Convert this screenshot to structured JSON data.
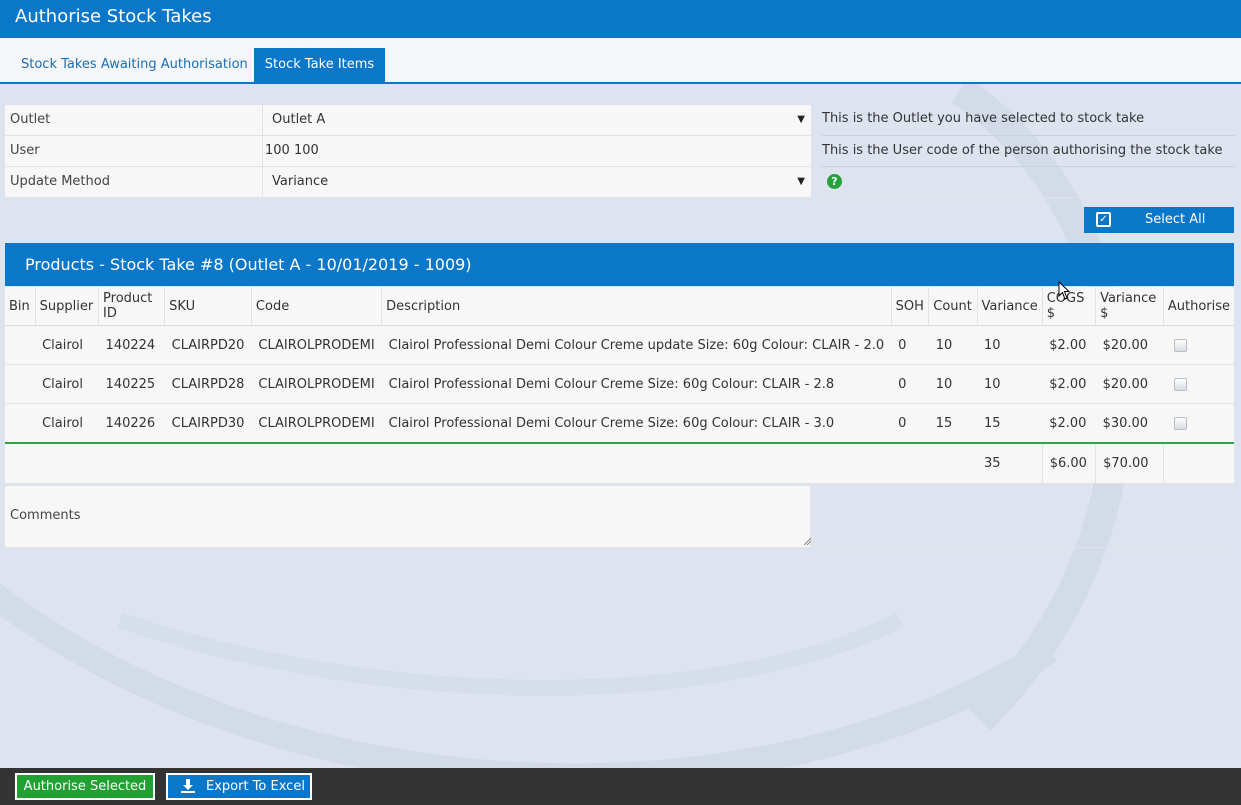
{
  "window": {
    "title": "Authorise Stock Takes"
  },
  "tabs": [
    {
      "label": "Stock Takes Awaiting Authorisation",
      "active": false
    },
    {
      "label": "Stock Take Items",
      "active": true
    }
  ],
  "form": {
    "outlet": {
      "label": "Outlet",
      "value": "Outlet A",
      "help": "This is the Outlet you have selected to stock take"
    },
    "user": {
      "label": "User",
      "value": "100 100",
      "help": "This is the User code of the person authorising the stock take"
    },
    "update_method": {
      "label": "Update Method",
      "value": "Variance",
      "help_icon": "question-circle-icon"
    }
  },
  "select_all": {
    "label": "Select All",
    "icon": "checkbox-checked-icon"
  },
  "products_panel": {
    "title": "Products - Stock Take #8 (Outlet A - 10/01/2019 - 1009)"
  },
  "table": {
    "headers": [
      "Bin",
      "Supplier",
      "Product ID",
      "SKU",
      "Code",
      "Description",
      "SOH",
      "Count",
      "Variance",
      "COGS $",
      "Variance $",
      "Authorise"
    ],
    "rows": [
      {
        "bin": "",
        "supplier": "Clairol",
        "product_id": "140224",
        "sku": "CLAIRPD20",
        "code": "CLAIROLPRODEMI",
        "description": "Clairol Professional Demi Colour Creme update Size: 60g Colour: CLAIR - 2.0",
        "soh": "0",
        "count": "10",
        "variance": "10",
        "cogs": "$2.00",
        "variance_dollar": "$20.00",
        "authorised": false
      },
      {
        "bin": "",
        "supplier": "Clairol",
        "product_id": "140225",
        "sku": "CLAIRPD28",
        "code": "CLAIROLPRODEMI",
        "description": "Clairol Professional Demi Colour Creme Size: 60g Colour: CLAIR - 2.8",
        "soh": "0",
        "count": "10",
        "variance": "10",
        "cogs": "$2.00",
        "variance_dollar": "$20.00",
        "authorised": false
      },
      {
        "bin": "",
        "supplier": "Clairol",
        "product_id": "140226",
        "sku": "CLAIRPD30",
        "code": "CLAIROLPRODEMI",
        "description": "Clairol Professional Demi Colour Creme Size: 60g Colour: CLAIR - 3.0",
        "soh": "0",
        "count": "15",
        "variance": "15",
        "cogs": "$2.00",
        "variance_dollar": "$30.00",
        "authorised": false
      }
    ],
    "totals": {
      "variance": "35",
      "cogs": "$6.00",
      "variance_dollar": "$70.00"
    }
  },
  "comments": {
    "label": "Comments",
    "value": ""
  },
  "footer": {
    "authorise_label": "Authorise Selected",
    "export_label": "Export To Excel",
    "export_icon": "download-icon"
  },
  "colors": {
    "primary": "#0a77c9",
    "success": "#22a133",
    "footer": "#333333",
    "background": "#dde4ef"
  }
}
